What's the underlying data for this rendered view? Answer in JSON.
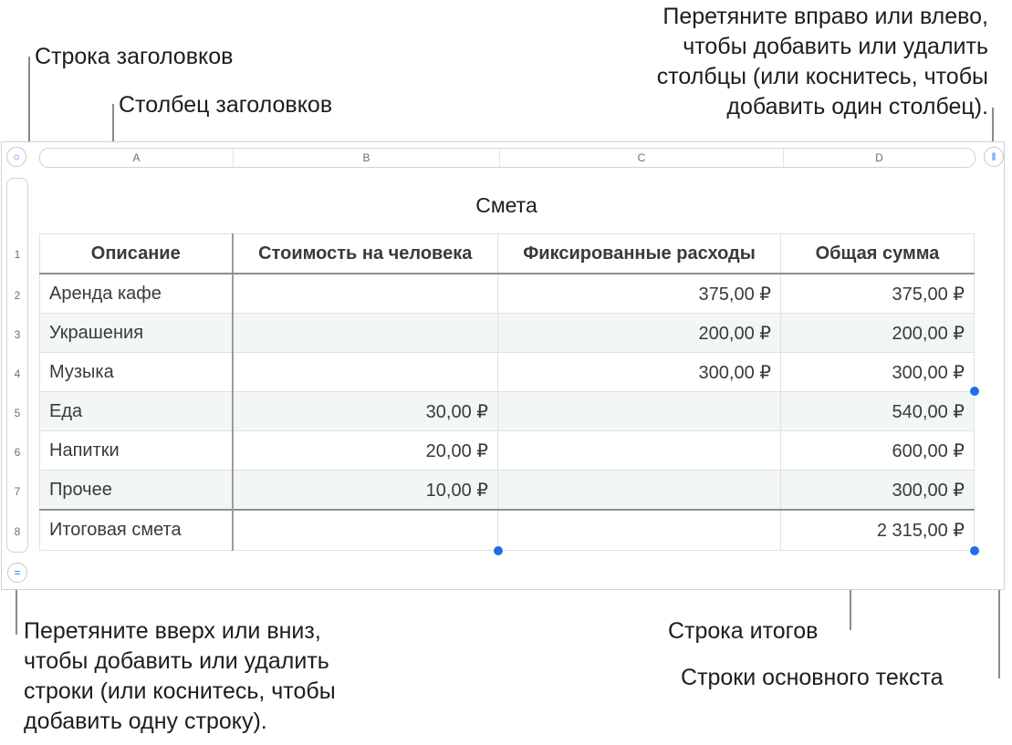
{
  "callouts": {
    "header_row": "Строка заголовков",
    "header_column": "Столбец заголовков",
    "add_columns": [
      "Перетяните вправо или влево,",
      "чтобы добавить или удалить",
      "столбцы (или коснитесь, чтобы",
      "добавить один столбец)."
    ],
    "add_rows": [
      "Перетяните вверх или вниз,",
      "чтобы добавить или удалить",
      "строки (или коснитесь, чтобы",
      "добавить одну строку)."
    ],
    "footer_row": "Строка итогов",
    "body_rows": "Строки основного текста"
  },
  "sheet": {
    "column_letters": [
      "A",
      "B",
      "C",
      "D"
    ],
    "row_numbers": [
      "1",
      "2",
      "3",
      "4",
      "5",
      "6",
      "7",
      "8"
    ],
    "title": "Смета",
    "headers": [
      "Описание",
      "Стоимость на человека",
      "Фиксированные расходы",
      "Общая сумма"
    ],
    "rows": [
      [
        "Аренда кафе",
        "",
        "375,00 ₽",
        "375,00 ₽"
      ],
      [
        "Украшения",
        "",
        "200,00 ₽",
        "200,00 ₽"
      ],
      [
        "Музыка",
        "",
        "300,00 ₽",
        "300,00 ₽"
      ],
      [
        "Еда",
        "30,00 ₽",
        "",
        "540,00 ₽"
      ],
      [
        "Напитки",
        "20,00 ₽",
        "",
        "600,00 ₽"
      ],
      [
        "Прочее",
        "10,00 ₽",
        "",
        "300,00 ₽"
      ]
    ],
    "footer": [
      "Итоговая смета",
      "",
      "",
      "2 315,00 ₽"
    ]
  },
  "controls": {
    "select_table_icon": "circle-icon",
    "add_column_icon": "pause-icon",
    "add_row_icon": "equals-icon"
  },
  "colors": {
    "accent": "#1e6fe3",
    "alt_row": "#f2f7f4"
  }
}
